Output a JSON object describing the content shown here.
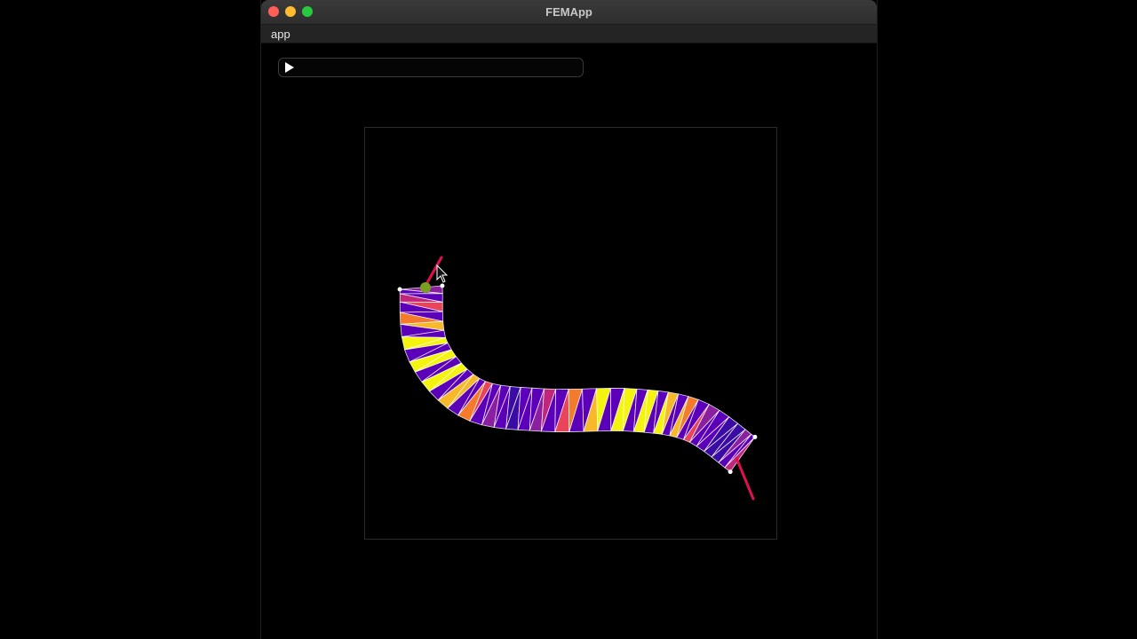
{
  "window": {
    "title": "FEMApp"
  },
  "menu": {
    "items": [
      "app"
    ]
  },
  "toolbar": {
    "play_icon": "play-icon"
  },
  "viewport": {
    "mesh_colors": [
      "#3a0ca3",
      "#5b00b8",
      "#8a1fa0",
      "#c0267a",
      "#e8455a",
      "#f47a2c",
      "#f7b92a",
      "#f4f40e"
    ],
    "wire_color": "#ffffff",
    "force_color": "#e0104f",
    "grab_color": "#7aa020"
  }
}
